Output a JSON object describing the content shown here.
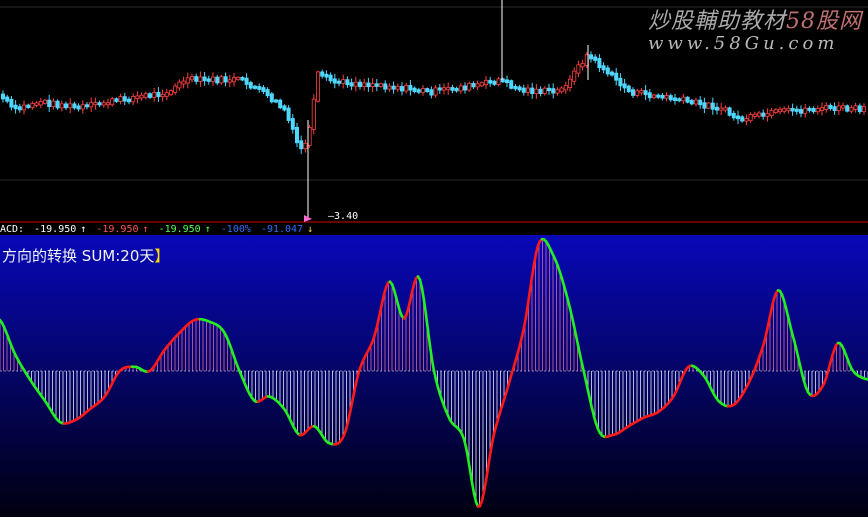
{
  "watermark": {
    "site_cn": "炒股輔助教材",
    "site_highlight": "58股网",
    "url": "www.58Gu.com"
  },
  "price_panel": {
    "low_label": "3.40"
  },
  "indicator_bar": {
    "name": "ACD:",
    "values": [
      "-19.950",
      "-19.950",
      "-19.950"
    ],
    "faint_values": [
      "-100%",
      "-91.047"
    ],
    "colors": [
      "#ffffff",
      "#ff5555",
      "#55ff55"
    ]
  },
  "indicator_panel": {
    "title": "方向的转换",
    "sum_label": "SUM:20天",
    "gradient_top": "#0808b8",
    "gradient_bottom": "#000010",
    "rising_color": "#ff1a1a",
    "falling_color": "#22ee22"
  },
  "chart_data": [
    {
      "type": "candlestick",
      "description": "price",
      "low_marker": 3.4,
      "colors": {
        "up": "#ff4040",
        "down": "#4fd8ff",
        "axis": "#8b0000"
      }
    },
    {
      "type": "line",
      "name": "ACD",
      "zero_line": true,
      "y": [
        60,
        20,
        -10,
        -35,
        -60,
        -58,
        -45,
        -30,
        0,
        5,
        0,
        25,
        45,
        60,
        58,
        45,
        0,
        -35,
        -30,
        -45,
        -75,
        -65,
        -85,
        -75,
        0,
        40,
        105,
        62,
        110,
        0,
        -55,
        -80,
        -160,
        -75,
        -15,
        50,
        150,
        135,
        80,
        0,
        -70,
        -75,
        -65,
        -55,
        -48,
        -30,
        5,
        -5,
        -35,
        -40,
        -15,
        30,
        95,
        40,
        -25,
        -17,
        33,
        0,
        -10
      ]
    }
  ]
}
